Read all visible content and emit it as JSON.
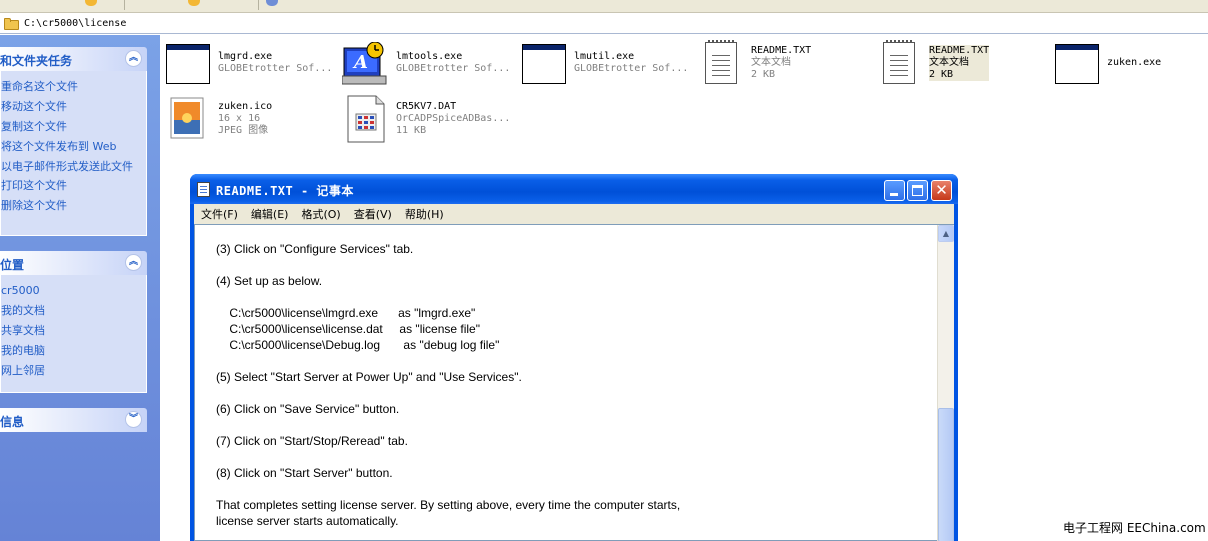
{
  "address": {
    "path": "C:\\cr5000\\license"
  },
  "task_pane": {
    "file_tasks": {
      "title": "和文件夹任务",
      "links": [
        "重命名这个文件",
        "移动这个文件",
        "复制这个文件",
        "将这个文件发布到 Web",
        "以电子邮件形式发送此文件",
        "打印这个文件",
        "删除这个文件"
      ]
    },
    "other_places": {
      "title": "位置",
      "links": [
        "cr5000",
        "我的文档",
        "共享文档",
        "我的电脑",
        "网上邻居"
      ]
    },
    "details": {
      "title": "信息"
    }
  },
  "files": [
    {
      "name": "lmgrd.exe",
      "line2": "GLOBEtrotter Sof...",
      "line3": "",
      "icon": "window-icon"
    },
    {
      "name": "lmtools.exe",
      "line2": "GLOBEtrotter Sof...",
      "line3": "",
      "icon": "lmtools-icon"
    },
    {
      "name": "lmutil.exe",
      "line2": "GLOBEtrotter Sof...",
      "line3": "",
      "icon": "window-icon"
    },
    {
      "name": "README.TXT",
      "line2": "文本文档",
      "line3": "2 KB",
      "icon": "text-document-icon"
    },
    {
      "name": "README.TXT",
      "line2": "文本文档",
      "line3": "2 KB",
      "icon": "text-document-icon"
    },
    {
      "name": "zuken.exe",
      "line2": "",
      "line3": "",
      "icon": "window-icon"
    },
    {
      "name": "zuken.ico",
      "line2": "16 x 16",
      "line3": "JPEG 图像",
      "icon": "image-icon"
    },
    {
      "name": "CR5KV7.DAT",
      "line2": "OrCADPSpiceADBas...",
      "line3": "11 KB",
      "icon": "dat-file-icon"
    }
  ],
  "notepad": {
    "title": "README.TXT - 记事本",
    "menu": [
      "文件(F)",
      "编辑(E)",
      "格式(O)",
      "查看(V)",
      "帮助(H)"
    ],
    "lines": [
      "(3) Click on \"Configure Services\" tab.",
      "",
      "(4) Set up as below.",
      "",
      "    C:\\cr5000\\license\\lmgrd.exe      as \"lmgrd.exe\"",
      "    C:\\cr5000\\license\\license.dat     as \"license file\"",
      "    C:\\cr5000\\license\\Debug.log       as \"debug log file\"",
      "",
      "(5) Select \"Start Server at Power Up\" and \"Use Services\".",
      "",
      "(6) Click on \"Save Service\" button.",
      "",
      "(7) Click on \"Start/Stop/Reread\" tab.",
      "",
      "(8) Click on \"Start Server\" button.",
      "",
      "That completes setting license server. By setting above, every time the computer starts,",
      "license server starts automatically."
    ]
  },
  "watermark": "电子工程网 EEChina.com"
}
